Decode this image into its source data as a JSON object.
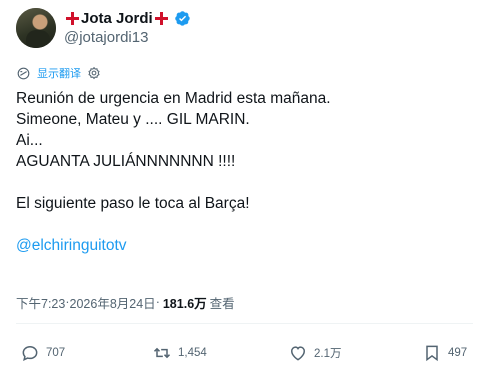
{
  "author": {
    "display_name": "Jota Jordi",
    "handle": "@jotajordi13"
  },
  "translate": {
    "label": "显示翻译"
  },
  "tweet": {
    "lines": [
      "Reunión de urgencia en Madrid esta mañana.",
      "Simeone, Mateu y .... GIL MARIN.",
      "Ai...",
      "AGUANTA JULIÁNNNNNNN !!!!",
      "El siguiente paso le toca al Barça!",
      "@elchiringuitotv"
    ]
  },
  "meta": {
    "time": "下午7:23",
    "sep1": " · ",
    "date": "2026年8月24日",
    "sep2": " · ",
    "views": "181.6万",
    "views_label": "查看"
  },
  "actions": {
    "replies": "707",
    "reposts": "1,454",
    "likes": "2.1万",
    "bookmarks": "497"
  },
  "colors": {
    "accent": "#1d9bf0",
    "text": "#0f1419",
    "muted": "#536471"
  }
}
